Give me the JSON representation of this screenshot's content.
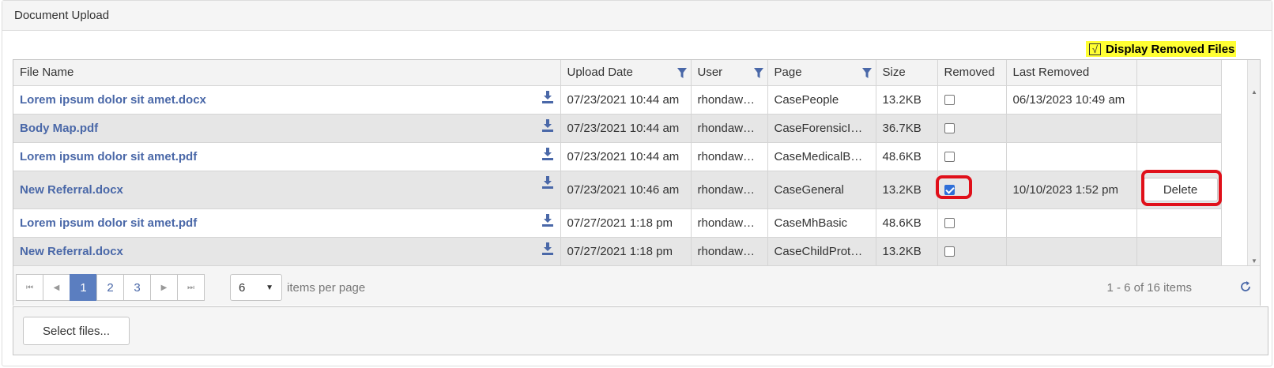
{
  "panel": {
    "title": "Document Upload"
  },
  "toggle": {
    "check_mark": "√",
    "label": "Display Removed Files"
  },
  "columns": [
    "File Name",
    "Upload Date",
    "User",
    "Page",
    "Size",
    "Removed",
    "Last Removed"
  ],
  "rows": [
    {
      "file": "Lorem ipsum dolor sit amet.docx",
      "date": "07/23/2021 10:44 am",
      "user": "rhondawu…",
      "page": "CasePeople",
      "size": "13.2KB",
      "removed": false,
      "last_removed": "06/13/2023 10:49 am",
      "action": ""
    },
    {
      "file": "Body Map.pdf",
      "date": "07/23/2021 10:44 am",
      "user": "rhondawu…",
      "page": "CaseForensicIn…",
      "size": "36.7KB",
      "removed": false,
      "last_removed": "",
      "action": ""
    },
    {
      "file": "Lorem ipsum dolor sit amet.pdf",
      "date": "07/23/2021 10:44 am",
      "user": "rhondawu…",
      "page": "CaseMedicalBa…",
      "size": "48.6KB",
      "removed": false,
      "last_removed": "",
      "action": ""
    },
    {
      "file": "New Referral.docx",
      "date": "07/23/2021 10:46 am",
      "user": "rhondawu…",
      "page": "CaseGeneral",
      "size": "13.2KB",
      "removed": true,
      "last_removed": "10/10/2023 1:52 pm",
      "action": "Delete"
    },
    {
      "file": "Lorem ipsum dolor sit amet.pdf",
      "date": "07/27/2021 1:18 pm",
      "user": "rhondawu…",
      "page": "CaseMhBasic",
      "size": "48.6KB",
      "removed": false,
      "last_removed": "",
      "action": ""
    },
    {
      "file": "New Referral.docx",
      "date": "07/27/2021 1:18 pm",
      "user": "rhondawu…",
      "page": "CaseChildProte…",
      "size": "13.2KB",
      "removed": false,
      "last_removed": "",
      "action": ""
    }
  ],
  "pager": {
    "first_icon": "first-page-icon",
    "prev_icon": "prev-page-icon",
    "next_icon": "next-page-icon",
    "last_icon": "last-page-icon",
    "pages": [
      "1",
      "2",
      "3"
    ],
    "current_page": "1",
    "page_size": "6",
    "per_page_label": "items per page",
    "info": "1 - 6 of 16 items"
  },
  "upload": {
    "select_label": "Select files..."
  },
  "colors": {
    "link": "#4a68a8",
    "active_page": "#5b7ec0",
    "highlight": "#ffff33",
    "annotation": "#e0101a"
  }
}
